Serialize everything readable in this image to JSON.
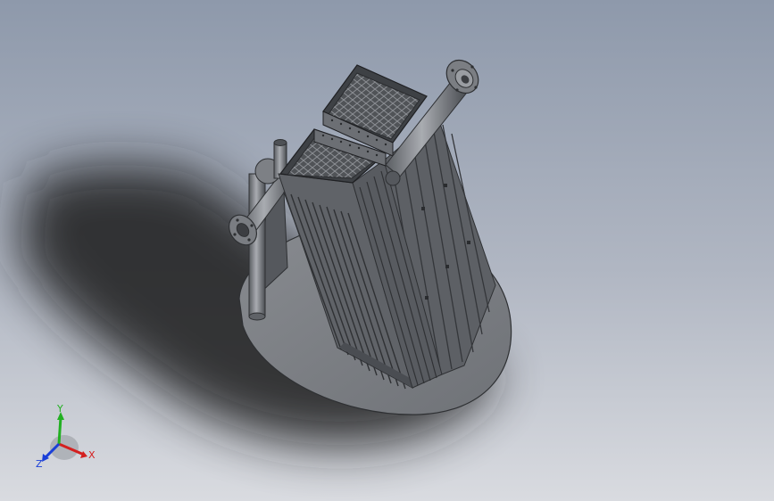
{
  "viewport": {
    "background_top": "#8e99ab",
    "background_bottom": "#d9dbe0"
  },
  "model": {
    "body_color": "#6b6e72",
    "dark_color": "#3a3c40",
    "light_color": "#9a9da2"
  },
  "triad": {
    "x_label": "X",
    "y_label": "Y",
    "z_label": "Z",
    "x_color": "#d42020",
    "y_color": "#22b022",
    "z_color": "#1a3fd8"
  }
}
